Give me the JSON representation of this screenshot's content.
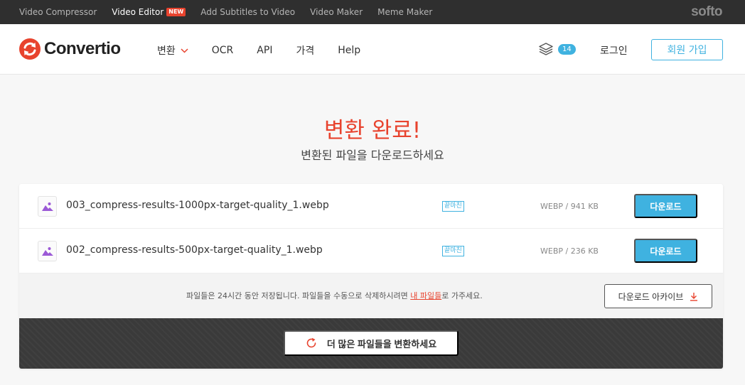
{
  "topbar": {
    "links": [
      {
        "label": "Video Compressor"
      },
      {
        "label": "Video Editor",
        "badge": "NEW"
      },
      {
        "label": "Add Subtitles to Video"
      },
      {
        "label": "Video Maker"
      },
      {
        "label": "Meme Maker"
      }
    ],
    "brand": "softo"
  },
  "header": {
    "logo_text": "Convertio",
    "nav": [
      "변환",
      "OCR",
      "API",
      "가격",
      "Help"
    ],
    "stack_count": "14",
    "login": "로그인",
    "signup": "회원 가입"
  },
  "hero": {
    "title": "변환 완료!",
    "subtitle": "변환된 파일을 다운로드하세요"
  },
  "files": [
    {
      "name": "003_compress-results-1000px-target-quality_1.webp",
      "status": "끝마친",
      "meta": "WEBP / 941 KB",
      "download": "다운로드"
    },
    {
      "name": "002_compress-results-500px-target-quality_1.webp",
      "status": "끝마친",
      "meta": "WEBP / 236 KB",
      "download": "다운로드"
    }
  ],
  "notice": {
    "before": "파일들은 24시간 동안 저장됩니다. 파일들을 수동으로 삭제하시려면 ",
    "link": "내 파일들",
    "after": "로 가주세요.",
    "archive": "다운로드 아카이브"
  },
  "convert_more": "더 많은 파일들을 변환하세요",
  "colors": {
    "accent_red": "#e8432e",
    "accent_blue": "#3fb2e0",
    "thumb_purple": "#9b59d6"
  }
}
